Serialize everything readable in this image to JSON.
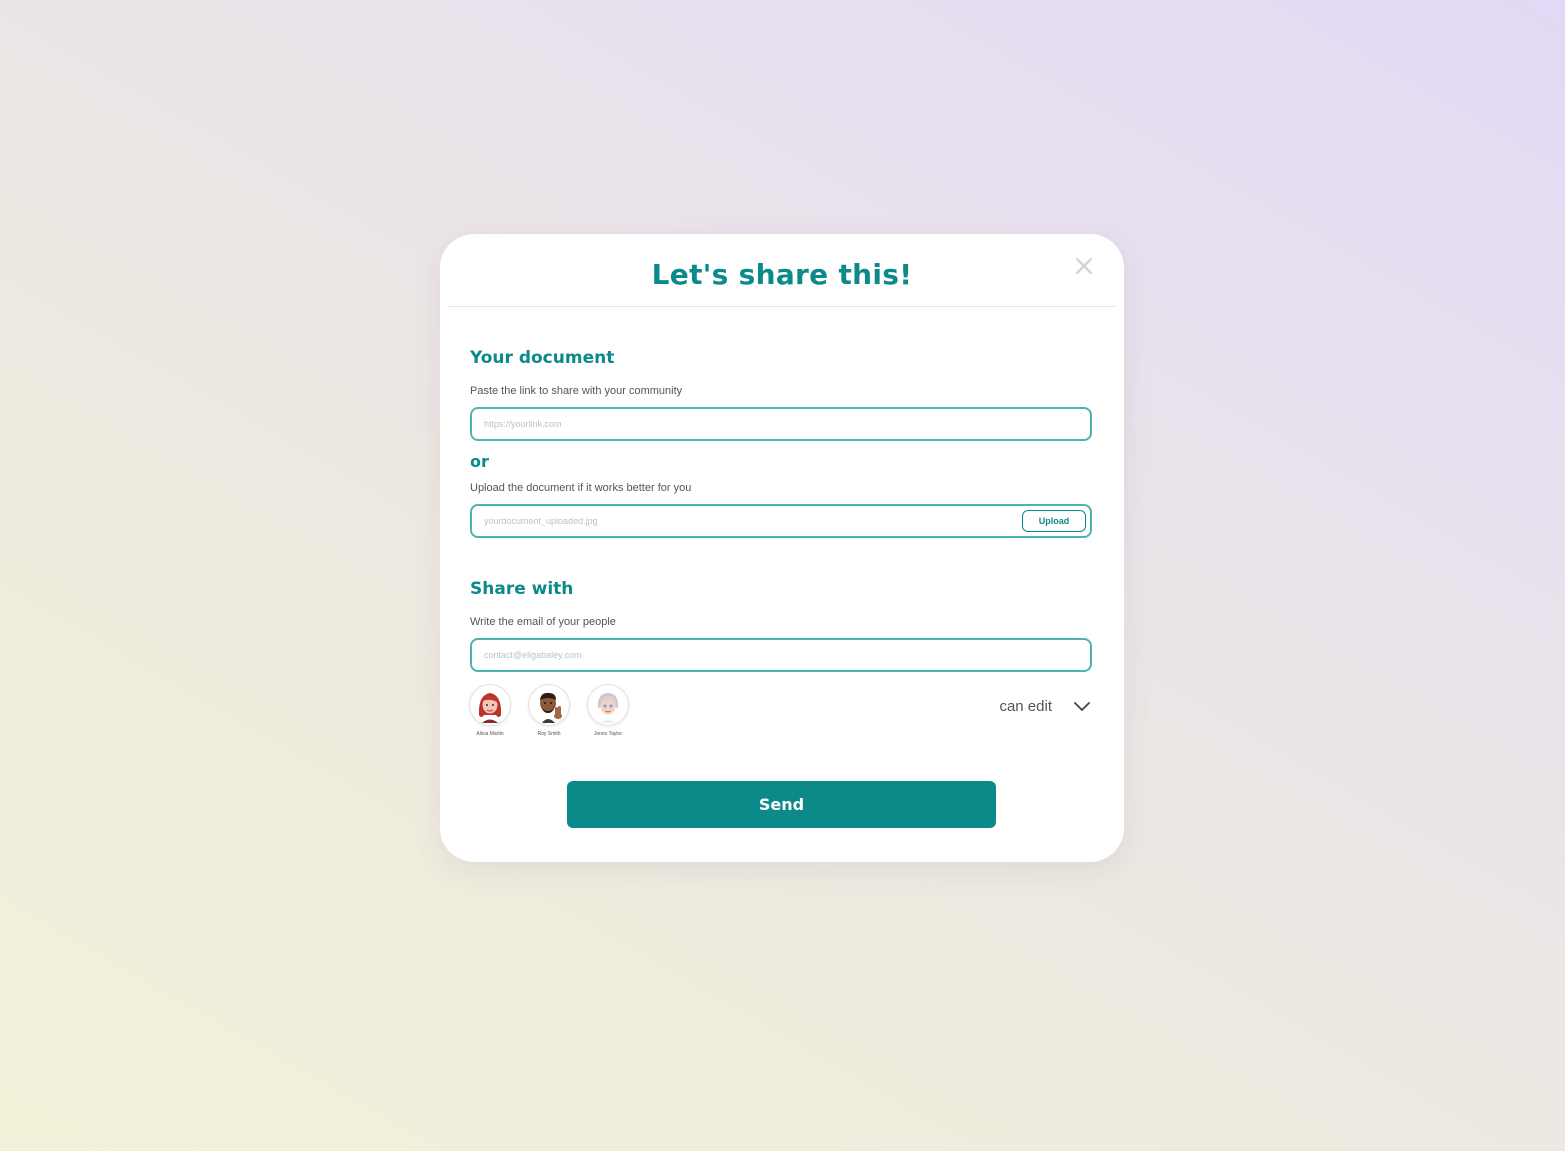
{
  "modal": {
    "title": "Let's share this!",
    "close_icon": "close-icon"
  },
  "document": {
    "heading": "Your document",
    "link_helper": "Paste the link to share with your community",
    "link_placeholder": "https://yourlink.com",
    "or_label": "or",
    "upload_helper": "Upload the document if it works better for you",
    "upload_placeholder": "yourdocument_uploaded.jpg",
    "upload_button": "Upload"
  },
  "share": {
    "heading": "Share with",
    "email_helper": "Write the email of your people",
    "email_placeholder": "contact@eligabaley.com",
    "people": [
      {
        "name": "Alicia Martin",
        "avatar_icon": "red-hair-woman-avatar"
      },
      {
        "name": "Roy Smith",
        "avatar_icon": "man-peace-sign-avatar"
      },
      {
        "name": "Jones Taylor",
        "avatar_icon": "grey-hair-woman-avatar"
      }
    ],
    "permission": "can edit",
    "permission_icon": "chevron-down-icon"
  },
  "actions": {
    "send": "Send"
  },
  "colors": {
    "accent": "#0c8a8a",
    "field_border": "#4fb3b3"
  }
}
